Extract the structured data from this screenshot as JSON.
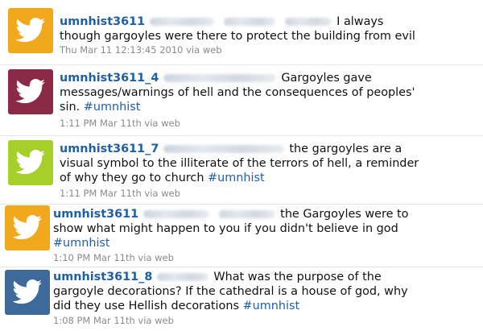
{
  "tweets": [
    {
      "username": "umnhist3611",
      "lines": [
        "I always",
        "though gargoyles were there to protect the building from evil"
      ],
      "meta": "Thu Mar 11 12:13:45 2010 via web",
      "avatar_color": "#f2a81d"
    },
    {
      "username": "umnhist3611_4",
      "lines": [
        "Gargoyles gave",
        "messages/warnings of hell and the consequences of peoples'",
        "sin."
      ],
      "hashtag": "#umnhist",
      "meta": "1:11 PM Mar 11th via web",
      "avatar_color": "#8a2a46"
    },
    {
      "username": "umnhist3611_7",
      "lines": [
        "the gargoyles are a",
        "visual symbol to the illiterate of the terrors of hell, a reminder",
        "of why they go to church"
      ],
      "hashtag": "#umnhist",
      "meta": "1:11 PM Mar 11th via web",
      "avatar_color": "#a6cf2a"
    },
    {
      "username": "umnhist3611",
      "lines": [
        "the Gargoyles were to",
        "show what might happen to you if you didn't believe in god"
      ],
      "hashtag": "#umnhist",
      "meta": "1:10 PM Mar 11th via web",
      "avatar_color": "#f2a81d"
    },
    {
      "username": "umnhist3611_8",
      "lines": [
        "What was the purpose of the",
        "gargoyle decorations? If the cathedral is a house of god, why",
        "did they use Hellish decorations"
      ],
      "hashtag": "#umnhist",
      "meta": "1:08 PM Mar 11th via web",
      "avatar_color": "#3d6a9a"
    }
  ]
}
